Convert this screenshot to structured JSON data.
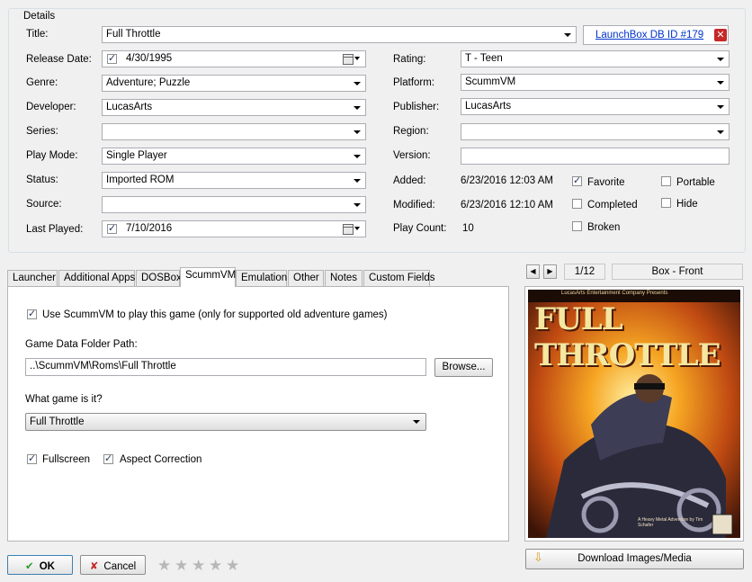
{
  "details": {
    "group_title": "Details",
    "title": {
      "label": "Title:",
      "value": "Full Throttle"
    },
    "db_link": "LaunchBox DB ID #179",
    "release_date": {
      "label": "Release Date:",
      "value": "4/30/1995",
      "checked": true
    },
    "genre": {
      "label": "Genre:",
      "value": "Adventure; Puzzle"
    },
    "developer": {
      "label": "Developer:",
      "value": "LucasArts"
    },
    "series": {
      "label": "Series:",
      "value": ""
    },
    "play_mode": {
      "label": "Play Mode:",
      "value": "Single Player"
    },
    "status": {
      "label": "Status:",
      "value": "Imported ROM"
    },
    "source": {
      "label": "Source:",
      "value": ""
    },
    "last_played": {
      "label": "Last Played:",
      "value": "7/10/2016",
      "checked": true
    },
    "rating": {
      "label": "Rating:",
      "value": "T - Teen"
    },
    "platform": {
      "label": "Platform:",
      "value": "ScummVM"
    },
    "publisher": {
      "label": "Publisher:",
      "value": "LucasArts"
    },
    "region": {
      "label": "Region:",
      "value": ""
    },
    "version": {
      "label": "Version:",
      "value": ""
    },
    "added": {
      "label": "Added:",
      "value": "6/23/2016 12:03 AM"
    },
    "modified": {
      "label": "Modified:",
      "value": "6/23/2016 12:10 AM"
    },
    "play_count": {
      "label": "Play Count:",
      "value": "10"
    },
    "flags": {
      "favorite": {
        "label": "Favorite",
        "checked": true
      },
      "completed": {
        "label": "Completed",
        "checked": false
      },
      "broken": {
        "label": "Broken",
        "checked": false
      },
      "portable": {
        "label": "Portable",
        "checked": false
      },
      "hide": {
        "label": "Hide",
        "checked": false
      }
    }
  },
  "tabs": [
    {
      "label": "Launcher"
    },
    {
      "label": "Additional Apps"
    },
    {
      "label": "DOSBox"
    },
    {
      "label": "ScummVM",
      "active": true
    },
    {
      "label": "Emulation"
    },
    {
      "label": "Other"
    },
    {
      "label": "Notes"
    },
    {
      "label": "Custom Fields"
    }
  ],
  "scummvm": {
    "use_label": "Use ScummVM to play this game (only for supported old adventure games)",
    "use_checked": true,
    "folder_label": "Game Data Folder Path:",
    "folder_value": "..\\ScummVM\\Roms\\Full Throttle",
    "browse_label": "Browse...",
    "which_game_label": "What game is it?",
    "which_game_value": "Full Throttle",
    "fullscreen_label": "Fullscreen",
    "fullscreen_checked": true,
    "aspect_label": "Aspect Correction",
    "aspect_checked": true
  },
  "media": {
    "counter": "1/12",
    "image_type": "Box - Front",
    "download_label": "Download Images/Media",
    "boxart": {
      "publisher_line": "LucasArts Entertainment Company Presents",
      "logo_text": "FULL THROTTLE",
      "tagline": "A Heavy Metal Adventure by Tim Schafer"
    }
  },
  "footer": {
    "ok_label": "OK",
    "cancel_label": "Cancel",
    "stars_filled": 0,
    "stars_total": 5
  }
}
